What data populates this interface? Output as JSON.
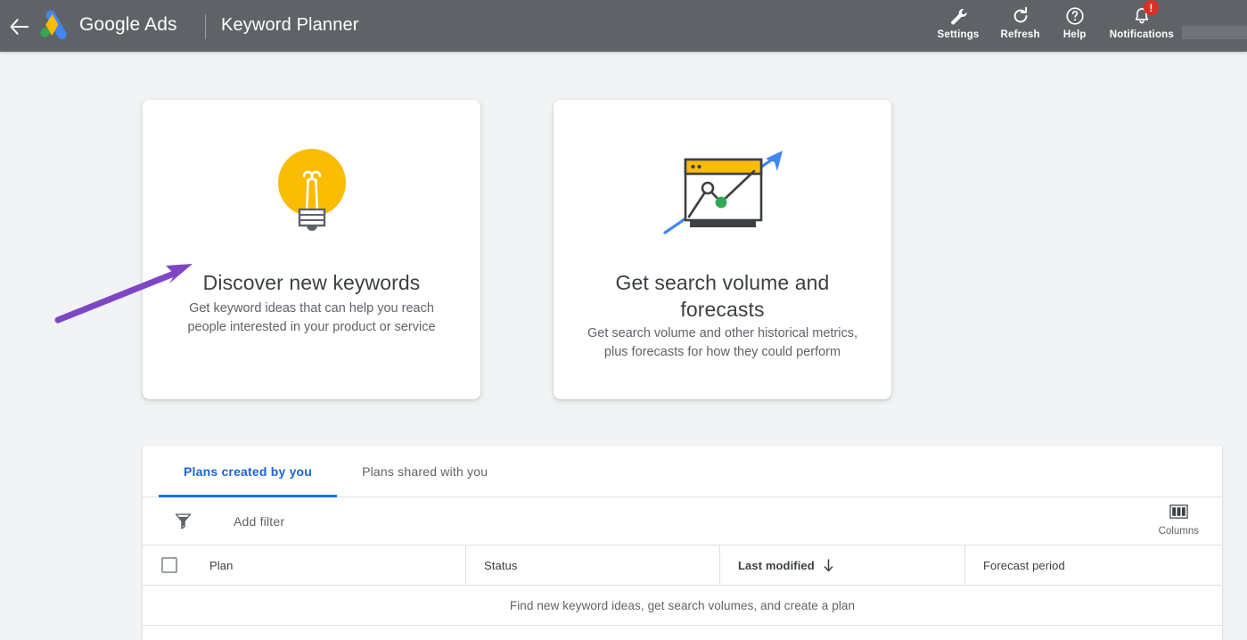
{
  "header": {
    "back_icon": "back-arrow-icon",
    "logo_icon": "google-ads-logo",
    "brand": "Google Ads",
    "title": "Keyword Planner",
    "actions": [
      {
        "label": "Settings",
        "icon": "wrench-icon"
      },
      {
        "label": "Refresh",
        "icon": "refresh-icon"
      },
      {
        "label": "Help",
        "icon": "help-circle-icon"
      },
      {
        "label": "Notifications",
        "icon": "bell-icon",
        "badge": "!"
      }
    ]
  },
  "cards": [
    {
      "id": "discover",
      "icon": "lightbulb-icon",
      "title": "Discover new keywords",
      "description": "Get keyword ideas that can help you reach people interested in your product or service"
    },
    {
      "id": "forecast",
      "icon": "forecast-chart-icon",
      "title": "Get search volume and forecasts",
      "description": "Get search volume and other historical metrics, plus forecasts for how they could perform"
    }
  ],
  "annotation": {
    "type": "arrow",
    "color": "#7e46c4",
    "points_to": "Discover new keywords"
  },
  "plans_panel": {
    "tabs": [
      {
        "label": "Plans created by you",
        "active": true
      },
      {
        "label": "Plans shared with you",
        "active": false
      }
    ],
    "filter_bar": {
      "filter_icon": "funnel-icon",
      "add_filter_label": "Add filter",
      "columns_icon": "columns-icon",
      "columns_label": "Columns"
    },
    "table": {
      "columns": [
        {
          "label": "Plan",
          "sorted": false
        },
        {
          "label": "Status",
          "sorted": false
        },
        {
          "label": "Last modified",
          "sorted": true,
          "sort_direction": "desc"
        },
        {
          "label": "Forecast period",
          "sorted": false
        }
      ],
      "rows": [],
      "empty_message": "Find new keyword ideas, get search volumes, and create a plan"
    }
  },
  "colors": {
    "header_bg": "#5f6368",
    "page_bg": "#f1f3f4",
    "accent_blue": "#1a73e8",
    "badge_red": "#d93025",
    "bulb_yellow": "#fbbc04",
    "node_green": "#34a853",
    "annotation_purple": "#7e46c4"
  }
}
